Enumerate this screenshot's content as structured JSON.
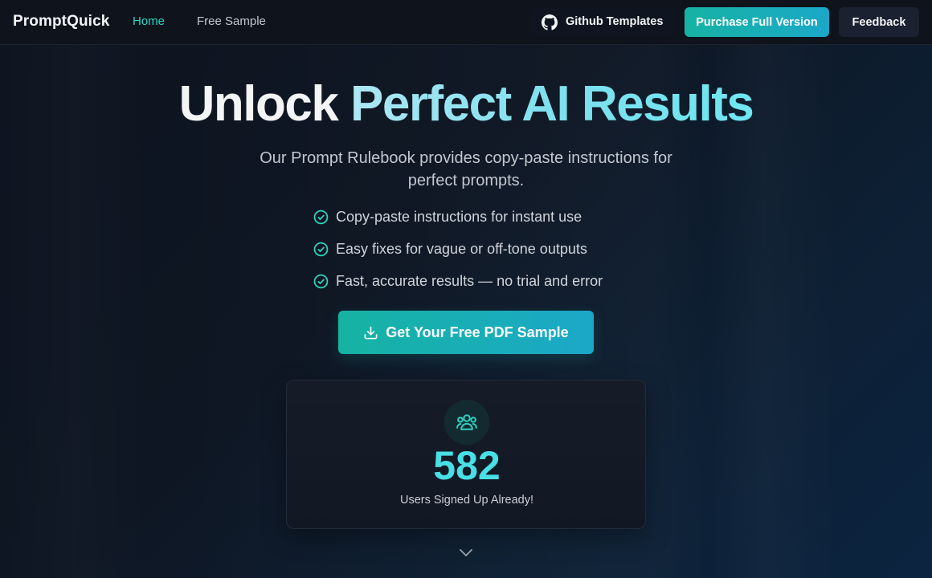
{
  "nav": {
    "brand": "PromptQuick",
    "links": [
      {
        "label": "Home",
        "active": true
      },
      {
        "label": "Free Sample",
        "active": false
      }
    ],
    "github_label": "Github Templates",
    "purchase_label": "Purchase Full Version",
    "feedback_label": "Feedback"
  },
  "hero": {
    "title_part1": "Unlock",
    "title_part2": "Perfect AI Results",
    "subtitle": "Our Prompt Rulebook provides copy-paste instructions for perfect prompts.",
    "features": [
      "Copy-paste instructions for instant use",
      "Easy fixes for vague or off-tone outputs",
      "Fast, accurate results — no trial and error"
    ],
    "cta_label": "Get Your Free PDF Sample"
  },
  "stats": {
    "count": "582",
    "label": "Users Signed Up Already!"
  },
  "icons": {
    "github": "github-icon",
    "check": "check-circle-icon",
    "download": "download-icon",
    "users": "users-icon",
    "scroll": "chevron-down-icon"
  },
  "colors": {
    "accent": "#2dd4bf",
    "accent_gradient_start": "#16b3a3",
    "accent_gradient_end": "#1ba8c8",
    "stat_number": "#48dfe6",
    "background": "#0e1420"
  }
}
